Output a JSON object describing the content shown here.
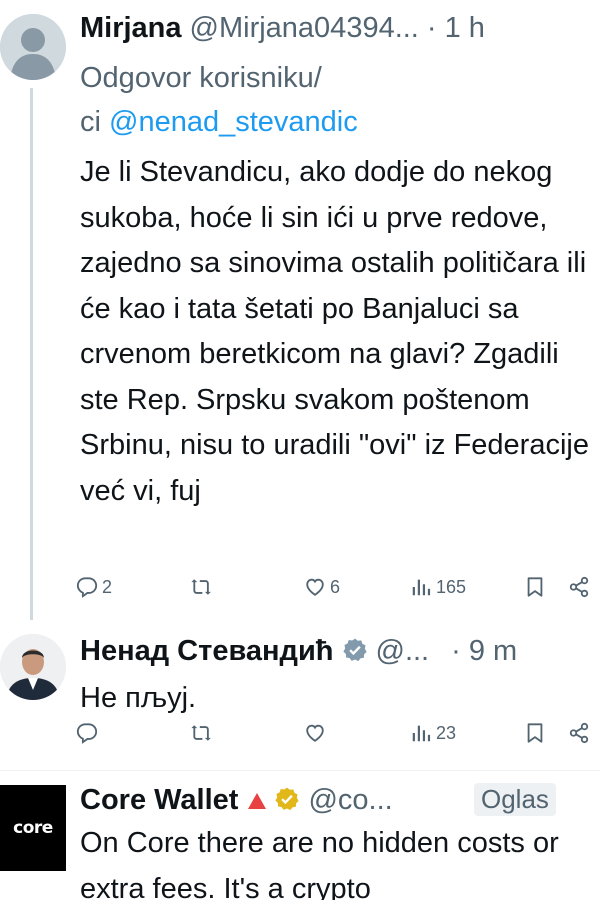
{
  "colors": {
    "text": "#0f1419",
    "secondary": "#536471",
    "link": "#1d9bf0",
    "verified_gray": "#829aab",
    "verified_gold": "#e2b719",
    "warning_red": "#e84142"
  },
  "tweets": [
    {
      "name": "Mirjana",
      "handle": "@Mirjana04394...",
      "time": "· 1 h",
      "reply_prefix_1": "Odgovor korisniku/",
      "reply_prefix_2": "ci ",
      "reply_mention": "@nenad_stevandic",
      "text": "Je li Stevandicu, ako dodje do nekog sukoba, hoće li sin ići u prve redove, zajedno sa sinovima ostalih političara ili će kao i tata šetati po Banjaluci sa crvenom beretkicom na glavi? Zgadili ste Rep. Srpsku svakom poštenom Srbinu, nisu to uradili \"ovi\" iz Federacije već vi, fuj",
      "replies": "2",
      "retweets": "",
      "likes": "6",
      "views": "165"
    },
    {
      "name": "Ненад Стевандић",
      "handle": "@...",
      "time": "· 9 m",
      "text": "Не пљуј.",
      "replies": "",
      "retweets": "",
      "likes": "",
      "views": "23"
    },
    {
      "name": "Core Wallet",
      "handle": "@co...",
      "ad_label": "Oglas",
      "avatar_text": "core",
      "text": "On Core there are no hidden costs or extra fees. It's a crypto"
    }
  ],
  "icons": {
    "reply": "reply-icon",
    "retweet": "retweet-icon",
    "like": "heart-icon",
    "views": "views-icon",
    "bookmark": "bookmark-icon",
    "share": "share-icon",
    "verified": "verified-badge-icon"
  }
}
